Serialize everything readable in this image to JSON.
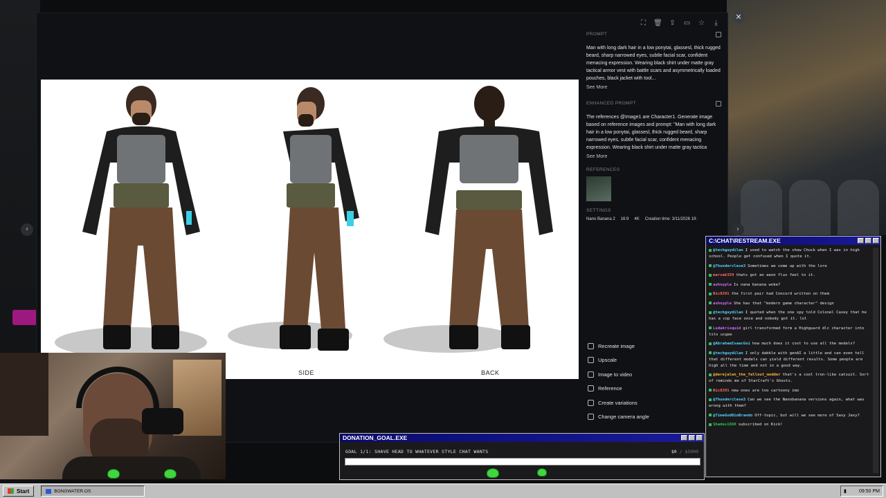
{
  "viewer": {
    "view_labels": [
      "SIDE",
      "BACK"
    ],
    "toolbar_icons": [
      "fullscreen-icon",
      "trash-icon",
      "share-icon",
      "folder-icon",
      "star-icon",
      "download-icon"
    ]
  },
  "info": {
    "prompt_heading": "PROMPT",
    "prompt_text": "Man with long dark hair in a low ponytai, glassesl, thick rugged beard, sharp narrowed eyes, subtle facial scar, confident menacing expression. Wearing black shirt under matte gray tactical armor vest with battle scars and asymmetrically loaded pouches, black jacket with tool...",
    "see_more_1": "See More",
    "enhanced_heading": "ENHANCED PROMPT",
    "enhanced_text": "The references @Image1 are Character1. Generate image based on reference images and prompt: \"Man with long dark hair in a low ponytai, glassesl, thick rugged beard, sharp narrowed eyes, subtle facial scar, confident menacing expression. Wearing black shirt under matte gray tactica",
    "see_more_2": "See More",
    "references_heading": "REFERENCES",
    "settings_heading": "SETTINGS",
    "settings": [
      "Nano Banana 2",
      "16:9",
      "4K",
      "Creation time: 3/11/2026 19:"
    ]
  },
  "actions": [
    "Recreate image",
    "Upscale",
    "Image to video",
    "Reference",
    "Create variations",
    "Change camera angle"
  ],
  "chat_window": {
    "title": "C:\\CHAT\\RESTREAM.EXE",
    "messages": [
      {
        "user": "@techguydilan",
        "text": "I used to watch the show Chuck when I was in high school. People get confused when I quote it.",
        "color": "#5ad0ff"
      },
      {
        "user": "@Thunderclese3",
        "text": "Sometimes we come up with the lore",
        "color": "#5ad0ff"
      },
      {
        "user": "marvak359",
        "text": "thats got an aeon flux feel to it.",
        "color": "#ff6a6a"
      },
      {
        "user": "auhnyple",
        "text": "Is nana banana woke?",
        "color": "#d06aff"
      },
      {
        "user": "Nic8201",
        "text": "the first pair had Concord written on them",
        "color": "#ff6a6a"
      },
      {
        "user": "auhnyple",
        "text": "She has that \"modern game character\" design",
        "color": "#d06aff"
      },
      {
        "user": "@techguydilan",
        "text": "I quoted when the one spy told Colonel Casey that he has a cop face once and nobody got it. lol",
        "color": "#5ad0ff"
      },
      {
        "user": "Ludakrisquid",
        "text": "girl transformed form a Highguard dlc character into tits ucgee",
        "color": "#d06aff"
      },
      {
        "user": "@AbrahamIsaacGoi",
        "text": "how much does it cost to use all the models?",
        "color": "#5ad0ff"
      },
      {
        "user": "@techguydilan",
        "text": "I only dabble with genAI a little and can even tell that different models can yield different results. Some people are high all the time and not in a good way.",
        "color": "#5ad0ff"
      },
      {
        "user": "@derejalen_the_fallout_modder",
        "text": "that's a cool tron-like catsuit. Sort of reminds me of StarCraft's Ghosts.",
        "color": "#ffb43a"
      },
      {
        "user": "Nic8201",
        "text": "new ones are too cartoony imo",
        "color": "#ff6a6a"
      },
      {
        "user": "@Thunderclese3",
        "text": "Can we see the Nanobanana versions again, what was wrong with them?",
        "color": "#5ad0ff"
      },
      {
        "user": "@TimeGodDioBrando",
        "text": "Off-topic, but will we see more of Saxy Jaxy?",
        "color": "#5ad0ff"
      },
      {
        "user": "Shades1869",
        "text": "subscribed on Kick!",
        "color": "#2ec25a"
      }
    ]
  },
  "goal_window": {
    "title": "DONATION_GOAL.EXE",
    "goal_text": "GOAL 1/1: SHAVE HEAD TO WHATEVER STYLE CHAT WANTS",
    "current": "$0",
    "target": " / $5000",
    "progress": 0
  },
  "taskbar": {
    "start_label": "Start",
    "app_label": "BONGWATER.OS",
    "clock": "09:50 PM"
  }
}
